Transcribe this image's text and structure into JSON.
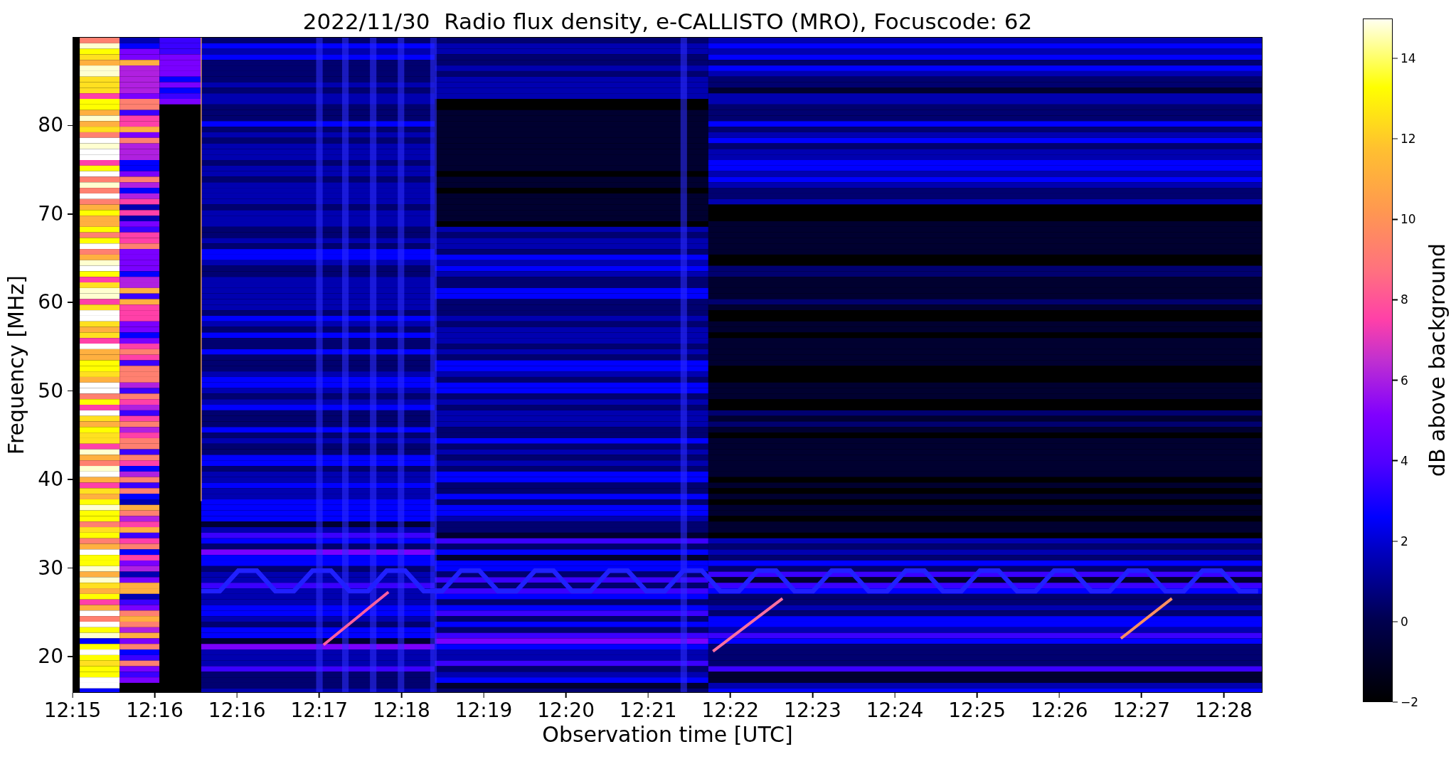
{
  "title": "2022/11/30  Radio flux density, e-CALLISTO (MRO), Focuscode: 62",
  "y_axis": {
    "label": "Frequency [MHz]",
    "ticks": [
      "80",
      "70",
      "60",
      "50",
      "40",
      "30",
      "20"
    ]
  },
  "x_axis": {
    "label": "Observation time [UTC]",
    "ticks": [
      "12:15",
      "12:16",
      "12:16",
      "12:17",
      "12:18",
      "12:19",
      "12:20",
      "12:21",
      "12:22",
      "12:23",
      "12:24",
      "12:25",
      "12:26",
      "12:27",
      "12:28"
    ]
  },
  "colorbar": {
    "label": "dB above background",
    "ticks": [
      "14",
      "12",
      "10",
      "8",
      "6",
      "4",
      "2",
      "0",
      "−2"
    ]
  }
}
